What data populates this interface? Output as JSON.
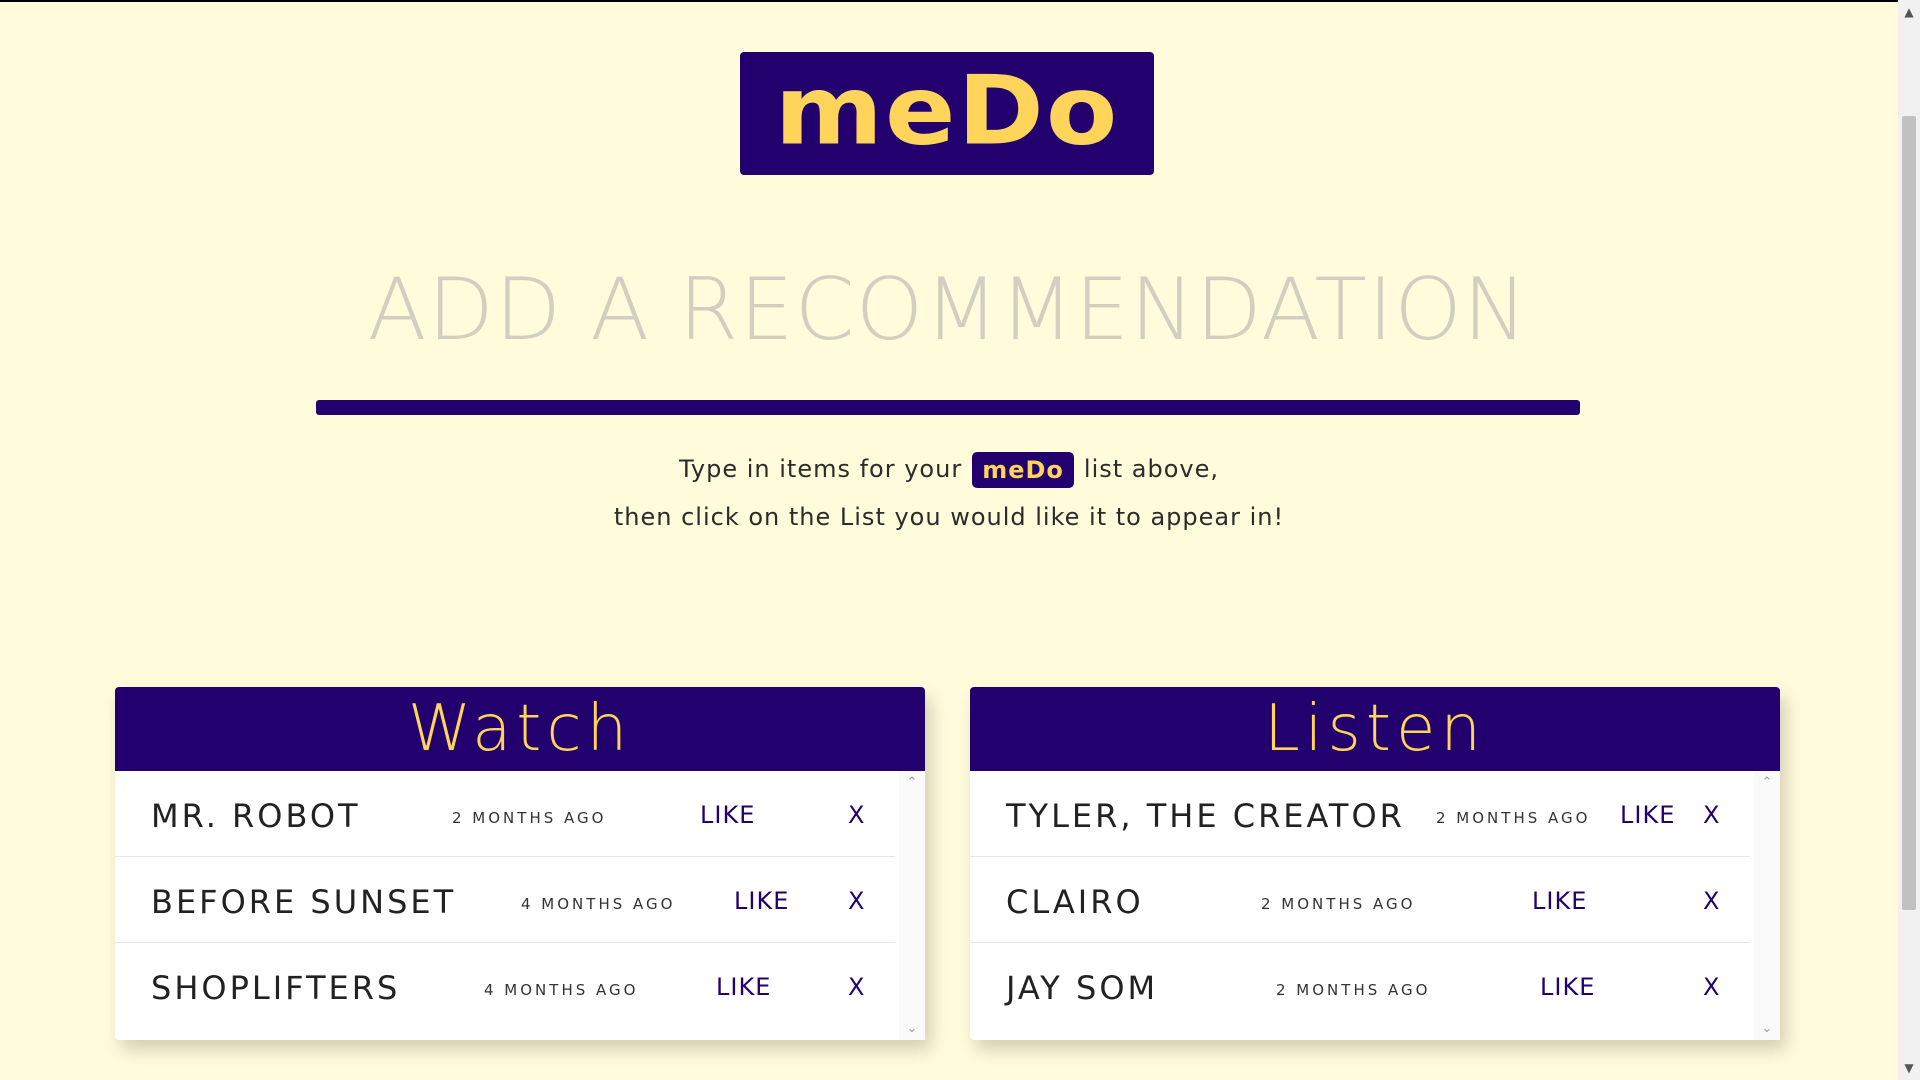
{
  "app": {
    "logo_text": "meDo",
    "mini_logo_text": "meDo"
  },
  "input": {
    "placeholder": "ADD A RECOMMENDATION"
  },
  "instructions": {
    "line1_before": "Type in items for your",
    "line1_after": "list above,",
    "line2": "then click on the List you would like it to appear in!"
  },
  "lists": {
    "watch": {
      "title": "Watch",
      "items": [
        {
          "title": "MR. ROBOT",
          "time": "2 MONTHS AGO",
          "like": "LIKE",
          "delete": "X"
        },
        {
          "title": "BEFORE SUNSET",
          "time": "4 MONTHS AGO",
          "like": "LIKE",
          "delete": "X"
        },
        {
          "title": "SHOPLIFTERS",
          "time": "4 MONTHS AGO",
          "like": "LIKE",
          "delete": "X"
        }
      ]
    },
    "listen": {
      "title": "Listen",
      "items": [
        {
          "title": "TYLER, THE CREATOR",
          "time": "2 MONTHS AGO",
          "like": "LIKE",
          "delete": "X"
        },
        {
          "title": "CLAIRO",
          "time": "2 MONTHS AGO",
          "like": "LIKE",
          "delete": "X"
        },
        {
          "title": "JAY SOM",
          "time": "2 MONTHS AGO",
          "like": "LIKE",
          "delete": "X"
        }
      ]
    }
  },
  "colors": {
    "background": "#fffbdb",
    "brand": "#22006d",
    "accent": "#ffd45a"
  }
}
